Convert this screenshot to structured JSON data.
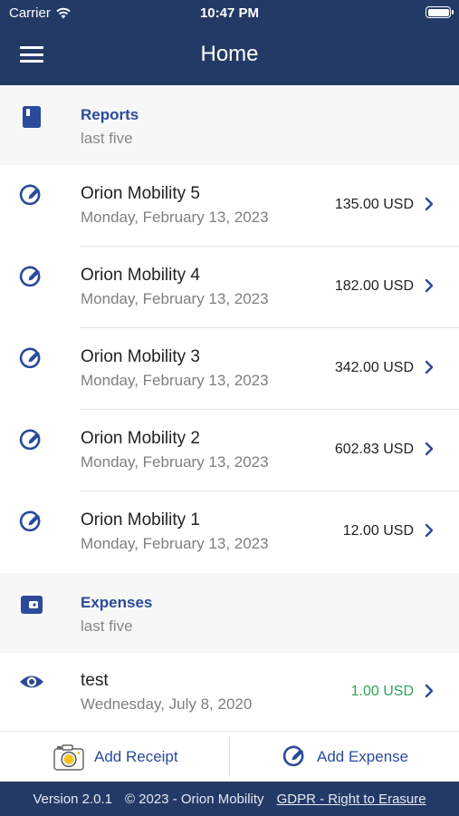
{
  "status_bar": {
    "carrier": "Carrier",
    "time": "10:47 PM"
  },
  "header": {
    "title": "Home"
  },
  "reports": {
    "title": "Reports",
    "subtitle": "last five",
    "items": [
      {
        "name": "Orion Mobility 5",
        "date": "Monday, February 13, 2023",
        "amount": "135.00 USD"
      },
      {
        "name": "Orion Mobility 4",
        "date": "Monday, February 13, 2023",
        "amount": "182.00 USD"
      },
      {
        "name": "Orion Mobility 3",
        "date": "Monday, February 13, 2023",
        "amount": "342.00 USD"
      },
      {
        "name": "Orion Mobility 2",
        "date": "Monday, February 13, 2023",
        "amount": "602.83 USD"
      },
      {
        "name": "Orion Mobility 1",
        "date": "Monday, February 13, 2023",
        "amount": "12.00 USD"
      }
    ]
  },
  "expenses": {
    "title": "Expenses",
    "subtitle": "last five",
    "items": [
      {
        "name": "test",
        "date": "Wednesday, July 8, 2020",
        "amount": "1.00 USD"
      }
    ]
  },
  "actions": {
    "add_receipt": "Add Receipt",
    "add_expense": "Add Expense"
  },
  "footer": {
    "version": "Version 2.0.1",
    "copyright": "© 2023 - Orion Mobility",
    "gdpr_link": "GDPR - Right to Erasure"
  },
  "colors": {
    "header_bg": "#243a66",
    "accent": "#2a4a9a",
    "positive_amount": "#2fa35a"
  }
}
